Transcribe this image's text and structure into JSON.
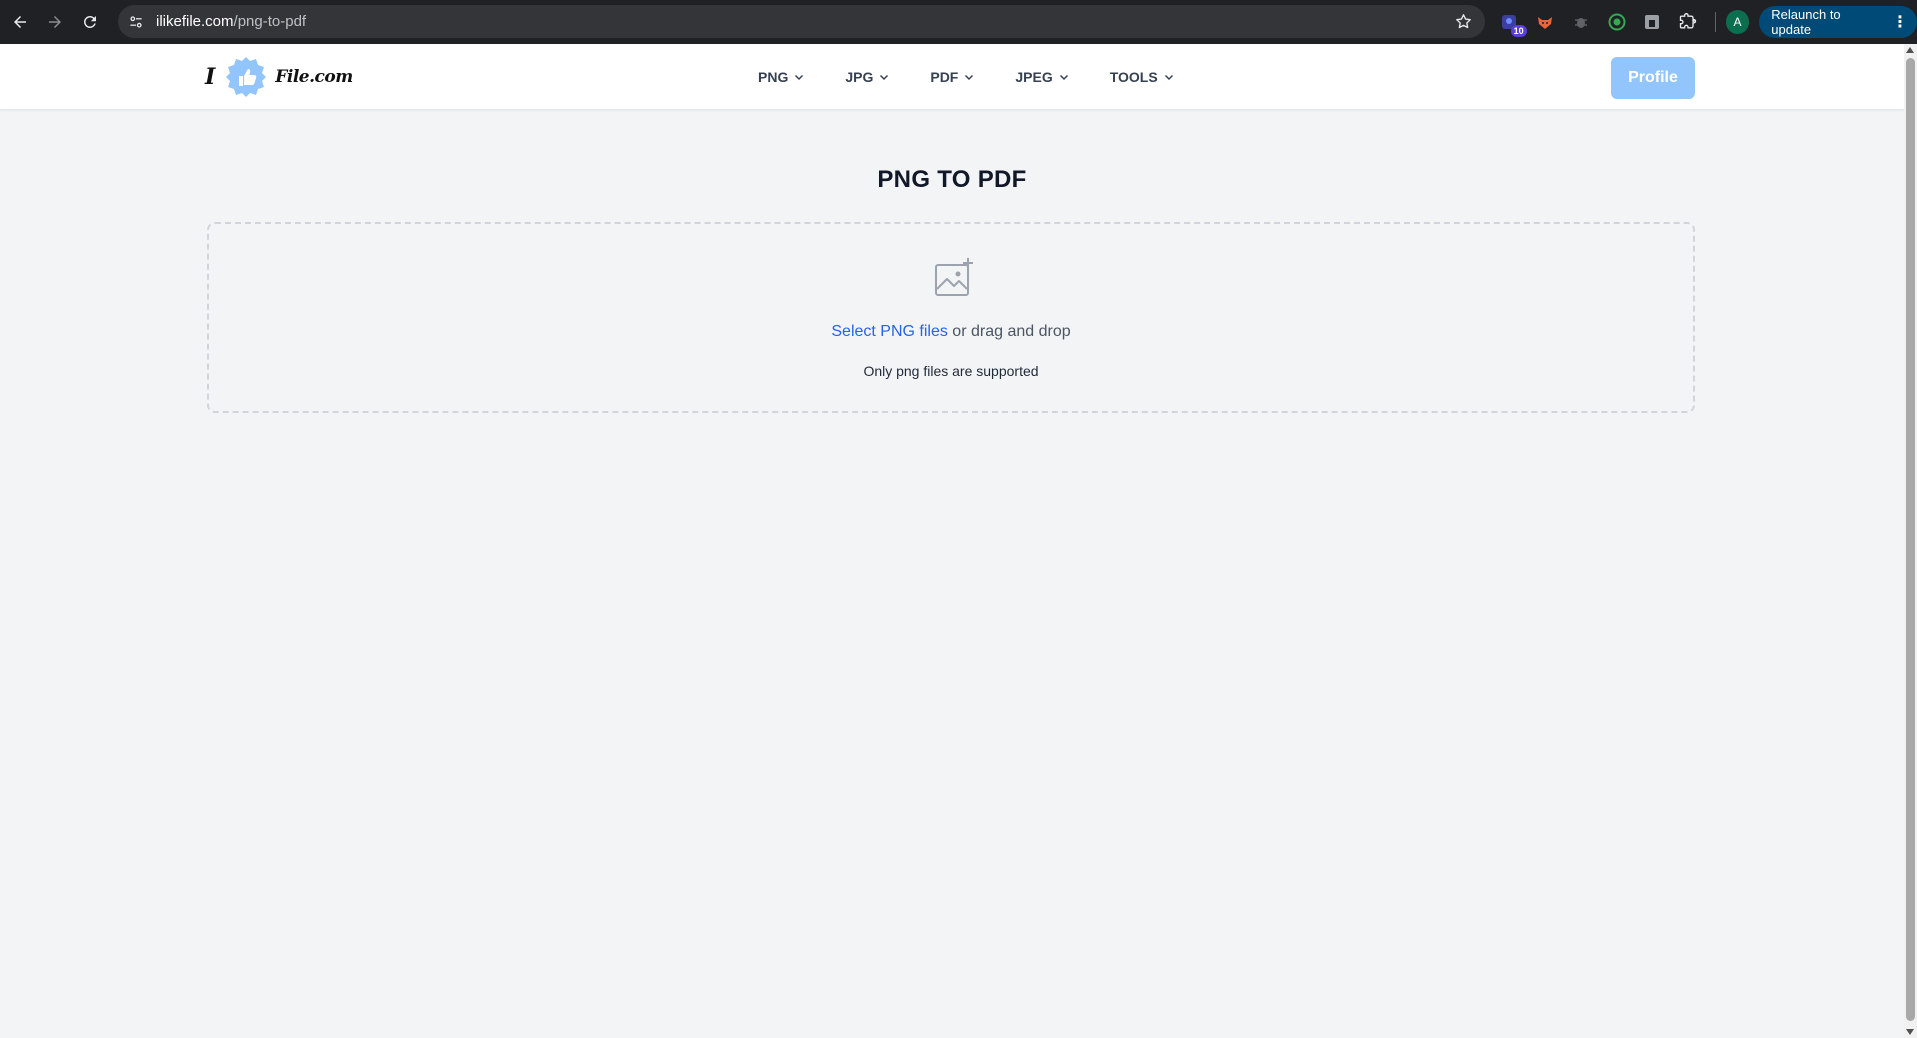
{
  "browser": {
    "url_host": "ilikefile.com",
    "url_path": "/png-to-pdf",
    "extension_badge": "10",
    "profile_initial": "A",
    "relaunch_label": "Relaunch to update",
    "icons": [
      "back-arrow-icon",
      "forward-arrow-icon",
      "reload-icon",
      "site-info-icon",
      "bookmark-star-icon",
      "extension-icon",
      "puzzle-icon",
      "kebab-menu-icon"
    ]
  },
  "site": {
    "logo": {
      "prefix": "I",
      "suffix": "File.com",
      "mark_color": "#93c5fd"
    },
    "nav": [
      {
        "label": "PNG"
      },
      {
        "label": "JPG"
      },
      {
        "label": "PDF"
      },
      {
        "label": "JPEG"
      },
      {
        "label": "TOOLS"
      }
    ],
    "profile_label": "Profile"
  },
  "main": {
    "title": "PNG TO PDF",
    "dropzone": {
      "link_text": "Select PNG files",
      "rest_text": " or drag and drop",
      "note": "Only png files are supported"
    }
  },
  "colors": {
    "accent_link": "#2563eb",
    "profile_button": "#93c5fd",
    "relaunch_bg": "#004a77"
  }
}
